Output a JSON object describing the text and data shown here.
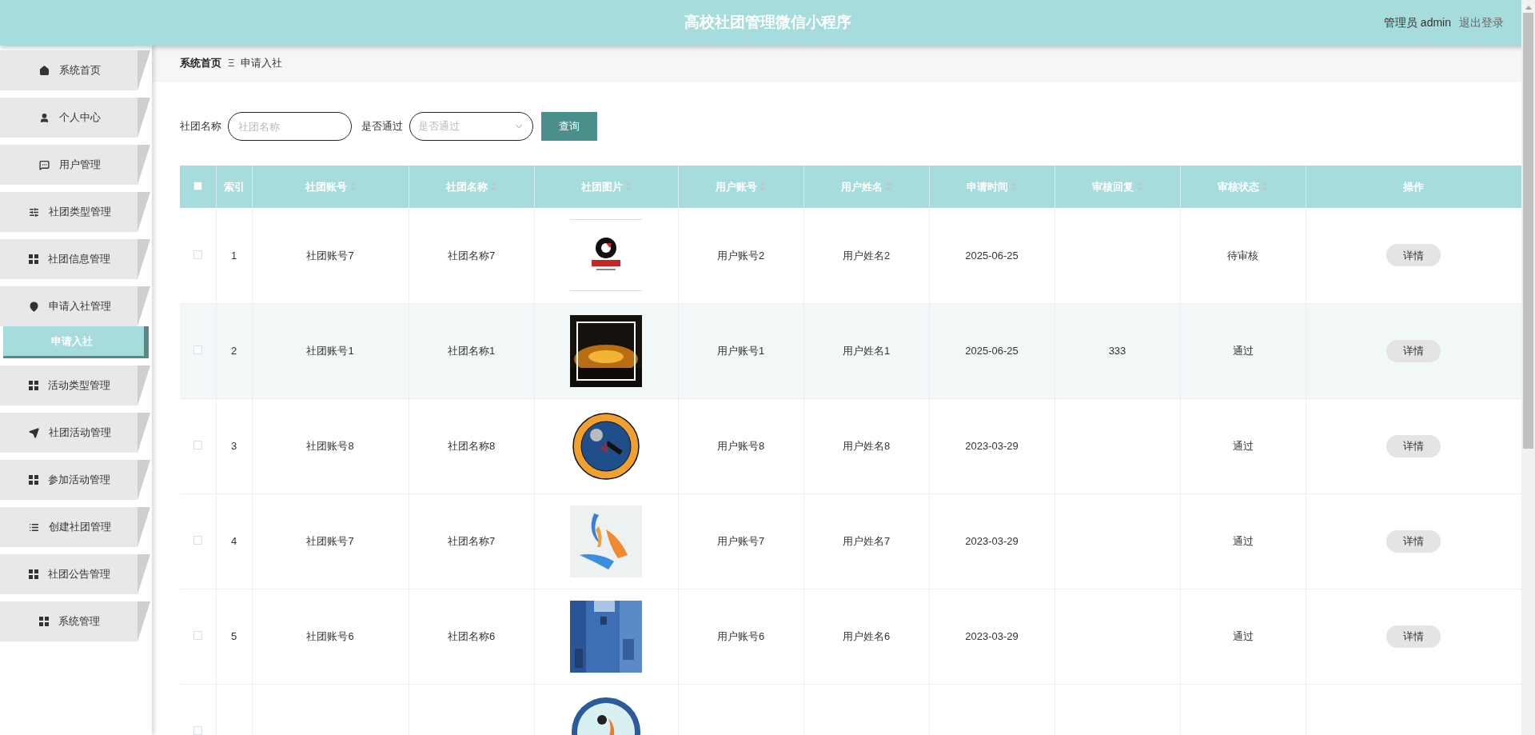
{
  "header": {
    "title": "高校社团管理微信小程序",
    "user": "管理员 admin",
    "logout": "退出登录"
  },
  "sidebar": {
    "items": [
      {
        "label": "系统首页",
        "selected": false
      },
      {
        "label": "个人中心",
        "selected": false
      },
      {
        "label": "用户管理",
        "selected": false
      },
      {
        "label": "社团类型管理",
        "selected": false
      },
      {
        "label": "社团信息管理",
        "selected": false
      },
      {
        "label": "申请入社管理",
        "selected": false,
        "children": [
          {
            "label": "申请入社",
            "selected": true
          }
        ]
      },
      {
        "label": "活动类型管理",
        "selected": false
      },
      {
        "label": "社团活动管理",
        "selected": false
      },
      {
        "label": "参加活动管理",
        "selected": false
      },
      {
        "label": "创建社团管理",
        "selected": false
      },
      {
        "label": "社团公告管理",
        "selected": false
      },
      {
        "label": "系统管理",
        "selected": false
      }
    ]
  },
  "breadcrumb": {
    "home": "系统首页",
    "separator": "Ξ",
    "current": "申请入社"
  },
  "search": {
    "fields": [
      {
        "label": "社团名称",
        "kind": "text",
        "placeholder": "社团名称"
      },
      {
        "label": "是否通过",
        "kind": "select",
        "placeholder": "是否通过"
      }
    ],
    "button": "查询"
  },
  "table": {
    "select_all": {
      "checked": false
    },
    "columns": [
      {
        "label": "索引",
        "sortable": false
      },
      {
        "label": "社团账号",
        "sortable": true
      },
      {
        "label": "社团名称",
        "sortable": true
      },
      {
        "label": "社团图片",
        "sortable": true
      },
      {
        "label": "用户账号",
        "sortable": true
      },
      {
        "label": "用户姓名",
        "sortable": true
      },
      {
        "label": "申请时间",
        "sortable": true
      },
      {
        "label": "审核回复",
        "sortable": true
      },
      {
        "label": "审核状态",
        "sortable": true
      },
      {
        "label": "操作",
        "sortable": false
      }
    ],
    "rows": [
      {
        "checked": false,
        "highlighted": false,
        "cells": [
          "1",
          "社团账号7",
          "社团名称7",
          null,
          "用户账号2",
          "用户姓名2",
          "2025-06-25",
          "",
          "待审核"
        ],
        "action": "详情"
      },
      {
        "checked": false,
        "highlighted": true,
        "cells": [
          "2",
          "社团账号1",
          "社团名称1",
          null,
          "用户账号1",
          "用户姓名1",
          "2025-06-25",
          "333",
          "通过"
        ],
        "action": "详情"
      },
      {
        "checked": false,
        "highlighted": false,
        "cells": [
          "3",
          "社团账号8",
          "社团名称8",
          null,
          "用户账号8",
          "用户姓名8",
          "2023-03-29",
          "",
          "通过"
        ],
        "action": "详情"
      },
      {
        "checked": false,
        "highlighted": false,
        "cells": [
          "4",
          "社团账号7",
          "社团名称7",
          null,
          "用户账号7",
          "用户姓名7",
          "2023-03-29",
          "",
          "通过"
        ],
        "action": "详情"
      },
      {
        "checked": false,
        "highlighted": false,
        "cells": [
          "5",
          "社团账号6",
          "社团名称6",
          null,
          "用户账号6",
          "用户姓名6",
          "2023-03-29",
          "",
          "通过"
        ],
        "action": "详情"
      },
      {
        "checked": false,
        "highlighted": false,
        "cells": []
      }
    ]
  }
}
